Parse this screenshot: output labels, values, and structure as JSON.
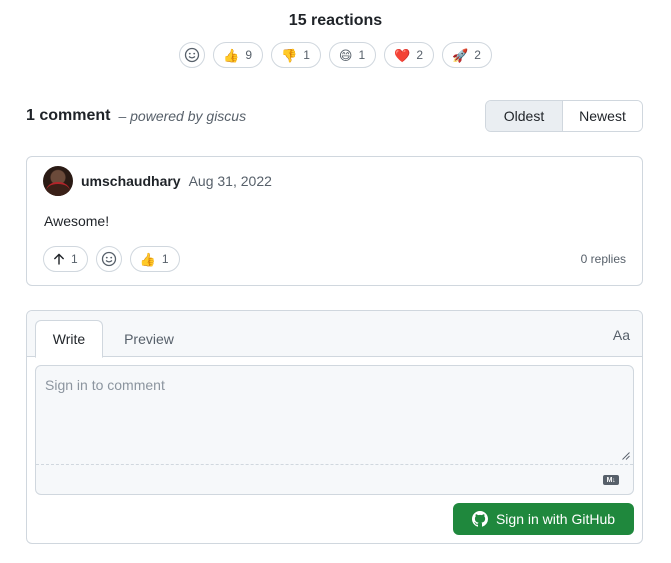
{
  "reactions": {
    "title": "15 reactions",
    "items": [
      {
        "emoji": "👍",
        "count": "9"
      },
      {
        "emoji": "👎",
        "count": "1"
      },
      {
        "emoji": "😄",
        "count": "1"
      },
      {
        "emoji": "❤️",
        "count": "2"
      },
      {
        "emoji": "🚀",
        "count": "2"
      }
    ]
  },
  "comments": {
    "count_label": "1 comment",
    "powered_by": "– powered by giscus",
    "sort": {
      "oldest": "Oldest",
      "newest": "Newest",
      "selected": "Oldest"
    }
  },
  "comment": {
    "author": "umschaudhary",
    "date": "Aug 31, 2022",
    "body": "Awesome!",
    "upvotes": "1",
    "reaction_emoji": "👍",
    "reaction_count": "1",
    "replies": "0 replies"
  },
  "editor": {
    "tab_write": "Write",
    "tab_preview": "Preview",
    "format_label": "Aa",
    "placeholder": "Sign in to comment",
    "markdown_badge": "M↓",
    "signin_label": "Sign in with GitHub"
  },
  "colors": {
    "primary_button": "#1f883d",
    "border": "#d0d7de",
    "muted_text": "#57606a"
  },
  "icons": {
    "add_reaction": "smiley-icon",
    "upvote": "arrow-up-icon",
    "github": "github-icon",
    "markdown": "markdown-icon"
  }
}
